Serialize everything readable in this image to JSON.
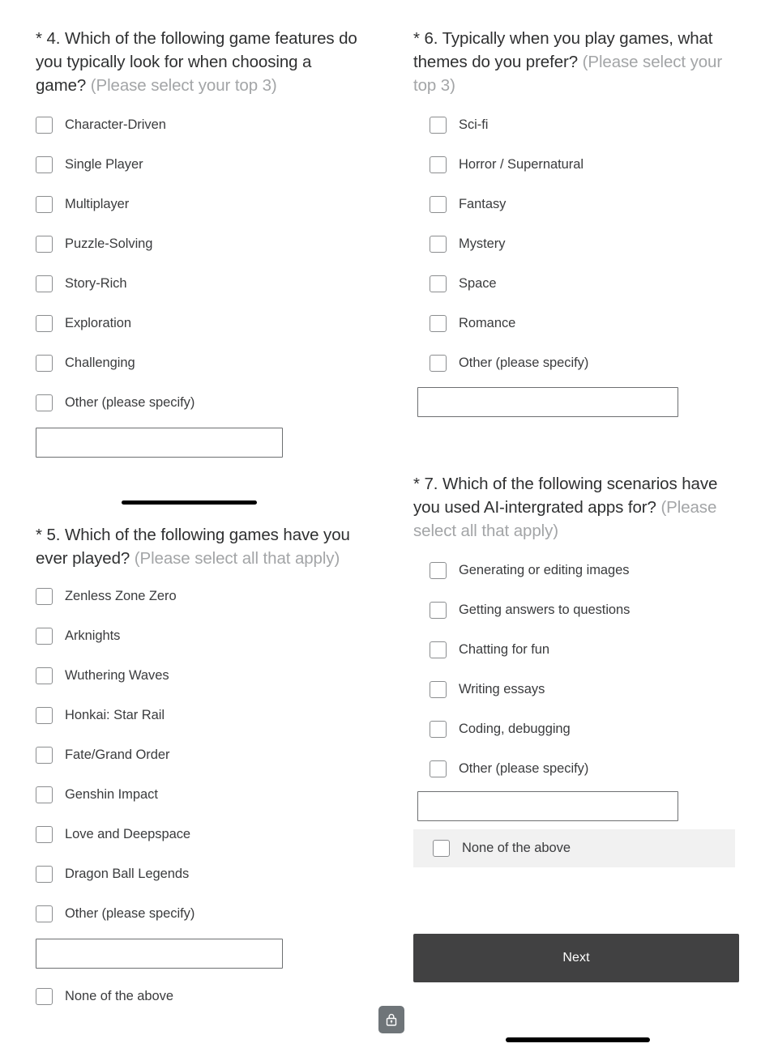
{
  "questions": [
    {
      "number": "* 4.",
      "text": "Which of the following game features do you typically look for when choosing a game?",
      "hint": "(Please select your top 3)",
      "options": [
        "Character-Driven",
        "Single Player",
        "Multiplayer",
        "Puzzle-Solving",
        "Story-Rich",
        "Exploration",
        "Challenging",
        "Other (please specify)"
      ],
      "other_input_value": "",
      "other_input_placeholder": ""
    },
    {
      "number": "* 5.",
      "text": "Which of the following games have you ever played?",
      "hint": "(Please select all that apply)",
      "options": [
        "Zenless Zone Zero",
        "Arknights",
        "Wuthering Waves",
        "Honkai: Star Rail",
        "Fate/Grand Order",
        "Genshin Impact",
        "Love and Deepspace",
        "Dragon Ball Legends",
        "Other (please specify)"
      ],
      "other_input_value": "",
      "other_input_placeholder": "",
      "none_option": "None of the above"
    },
    {
      "number": "* 6.",
      "text": "Typically when you play games, what themes do you prefer?",
      "hint": "(Please select your top 3)",
      "options": [
        "Sci-fi",
        "Horror / Supernatural",
        "Fantasy",
        "Mystery",
        "Space",
        "Romance",
        "Other (please specify)"
      ],
      "other_input_value": "",
      "other_input_placeholder": ""
    },
    {
      "number": "* 7.",
      "text": "Which of the following scenarios have you used AI-intergrated apps for?",
      "hint": "(Please select all that apply)",
      "options": [
        "Generating or editing images",
        "Getting answers to questions",
        "Chatting for fun",
        "Writing essays",
        "Coding, debugging",
        "Other (please specify)"
      ],
      "other_input_value": "",
      "other_input_placeholder": "",
      "none_option": "None of the above"
    }
  ],
  "footer": {
    "next_label": "Next",
    "lock_icon": "lock-icon"
  },
  "colors": {
    "text": "#3b3c3e",
    "hint": "#a3a5a7",
    "button_bg": "#414142",
    "highlight_bg": "#f1f1f1",
    "checkbox_border": "#8b8d8f"
  }
}
